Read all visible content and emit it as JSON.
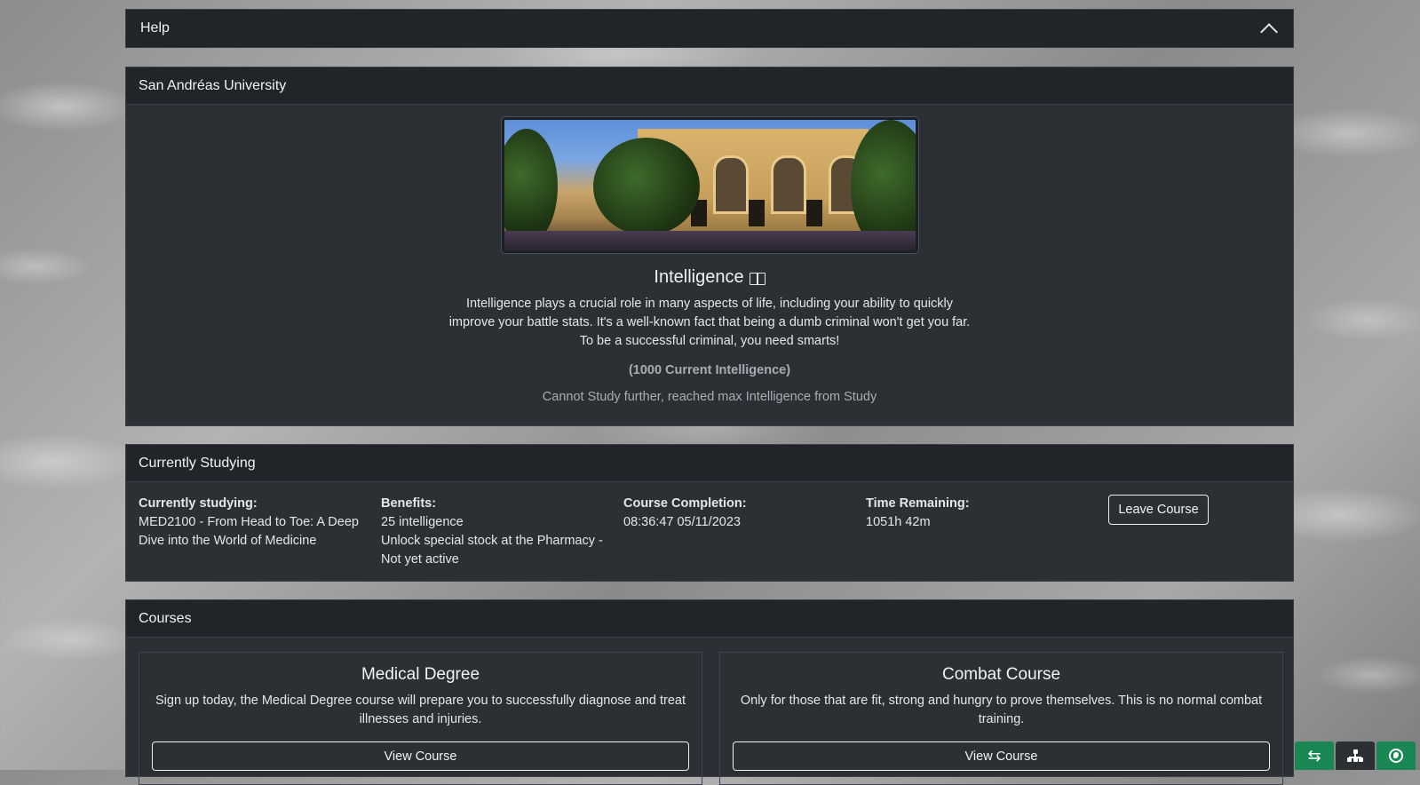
{
  "help": {
    "label": "Help"
  },
  "university": {
    "header": "San Andréas University",
    "subject_title": "Intelligence",
    "description": "Intelligence plays a crucial role in many aspects of life, including your ability to quickly improve your battle stats. It's a well-known fact that being a dumb criminal won't get you far. To be a successful criminal, you need smarts!",
    "current_stat": "(1000 Current Intelligence)",
    "status_message": "Cannot Study further, reached max Intelligence from Study"
  },
  "studying": {
    "header": "Currently Studying",
    "course_label": "Currently studying:",
    "course_value": "MED2100 - From Head to Toe: A Deep Dive into the World of Medicine",
    "benefits_label": "Benefits:",
    "benefit_1": "25 intelligence",
    "benefit_2": "Unlock special stock at the Pharmacy - Not yet active",
    "completion_label": "Course Completion:",
    "completion_value": "08:36:47 05/11/2023",
    "remaining_label": "Time Remaining:",
    "remaining_value": "1051h 42m",
    "leave_button": "Leave Course"
  },
  "courses": {
    "header": "Courses",
    "items": [
      {
        "title": "Medical Degree",
        "description": "Sign up today, the Medical Degree course will prepare you to successfully diagnose and treat illnesses and injuries.",
        "button": "View Course"
      },
      {
        "title": "Combat Course",
        "description": "Only for those that are fit, strong and hungry to prove themselves. This is no normal combat training.",
        "button": "View Course"
      }
    ]
  },
  "floating_buttons": {
    "swap": "⇆"
  },
  "icons": {
    "help_toggle": "chevron-up-icon",
    "subject": "book-icon",
    "fab_1": "swap-icon",
    "fab_2": "sitemap-icon",
    "fab_3": "globe-icon"
  },
  "colors": {
    "card_bg": "#2b3035",
    "header_bg": "#212529",
    "accent_green": "#198754"
  }
}
